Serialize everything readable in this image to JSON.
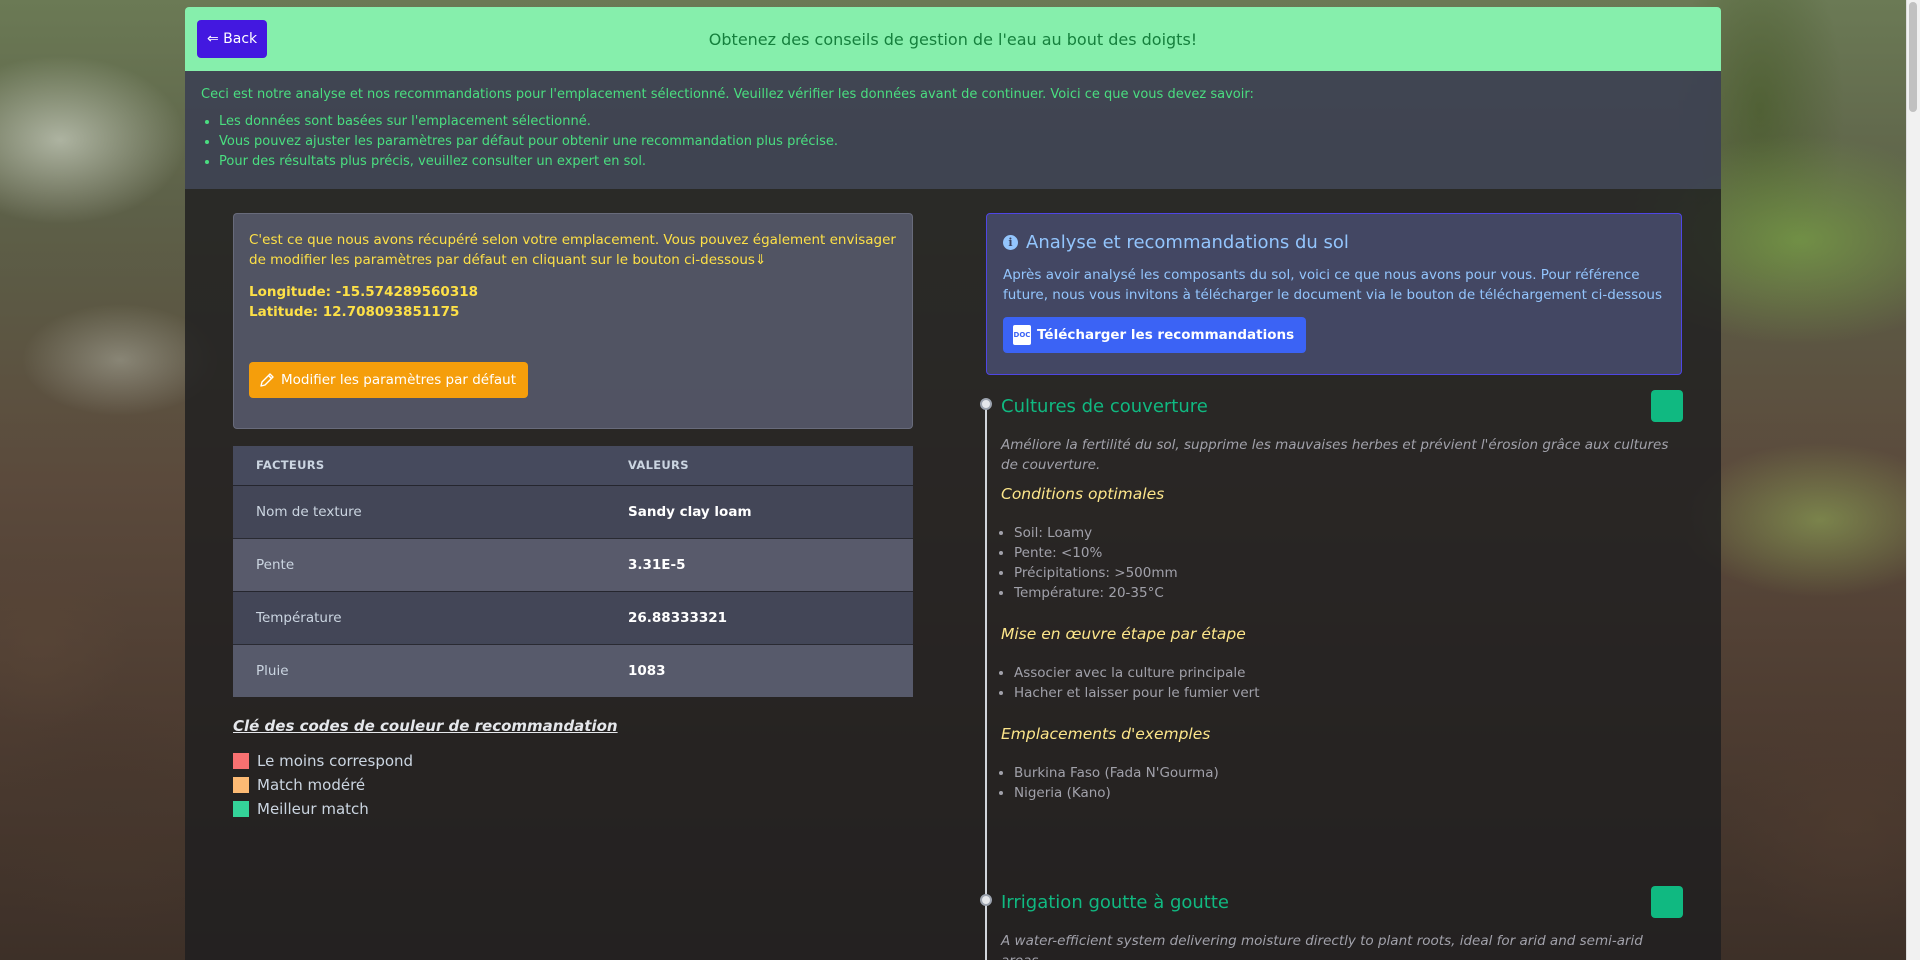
{
  "header": {
    "back_label": "⇐ Back",
    "title": "Obtenez des conseils de gestion de l'eau au bout des doigts!"
  },
  "info": {
    "intro": "Ceci est notre analyse et nos recommandations pour l'emplacement sélectionné. Veuillez vérifier les données avant de continuer. Voici ce que vous devez savoir:",
    "bullets": [
      "Les données sont basées sur l'emplacement sélectionné.",
      "Vous pouvez ajuster les paramètres par défaut pour obtenir une recommandation plus précise.",
      "Pour des résultats plus précis, veuillez consulter un expert en sol."
    ]
  },
  "location": {
    "text": "C'est ce que nous avons récupéré selon votre emplacement. Vous pouvez également envisager de modifier les paramètres par défaut en cliquant sur le bouton ci-dessous⇓",
    "longitude": "Longitude: -15.574289560318",
    "latitude": "Latitude: 12.708093851175",
    "edit_label": "Modifier les paramètres par défaut"
  },
  "table": {
    "headers": [
      "FACTEURS",
      "VALEURS"
    ],
    "rows": [
      {
        "factor": "Nom de texture",
        "value": "Sandy clay loam"
      },
      {
        "factor": "Pente",
        "value": "3.31E-5"
      },
      {
        "factor": "Température",
        "value": "26.88333321"
      },
      {
        "factor": "Pluie",
        "value": "1083"
      }
    ]
  },
  "legend": {
    "title": "Clé des codes de couleur de recommandation",
    "items": [
      {
        "label": "Le moins correspond",
        "color": "#f87171"
      },
      {
        "label": "Match modéré",
        "color": "#fdba74"
      },
      {
        "label": "Meilleur match",
        "color": "#34d399"
      }
    ]
  },
  "soil": {
    "title": "Analyse et recommandations du sol",
    "desc": "Après avoir analysé les composants du sol, voici ce que nous avons pour vous. Pour référence future, nous vous invitons à télécharger le document via le bouton de téléchargement ci-dessous",
    "download_label": "Télécharger les recommandations",
    "doc_icon_text": "DOC"
  },
  "recommendations": [
    {
      "title": "Cultures de couverture",
      "desc": "Améliore la fertilité du sol, supprime les mauvaises herbes et prévient l'érosion grâce aux cultures de couverture.",
      "sections": [
        {
          "heading": "Conditions optimales",
          "items": [
            "Soil: Loamy",
            "Pente: <10%",
            "Précipitations: >500mm",
            "Température: 20-35°C"
          ]
        },
        {
          "heading": "Mise en œuvre étape par étape",
          "items": [
            "Associer avec la culture principale",
            "Hacher et laisser pour le fumier vert"
          ]
        },
        {
          "heading": "Emplacements d'exemples",
          "items": [
            "Burkina Faso (Fada N'Gourma)",
            "Nigeria (Kano)"
          ]
        }
      ]
    },
    {
      "title": "Irrigation goutte à goutte",
      "desc": "A water-efficient system delivering moisture directly to plant roots, ideal for arid and semi-arid areas."
    }
  ]
}
